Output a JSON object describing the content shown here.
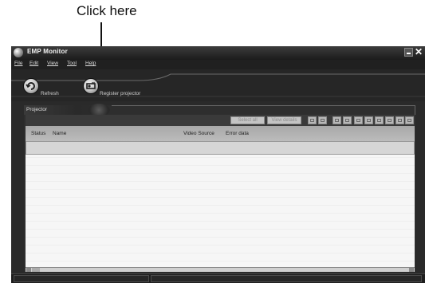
{
  "annotation": {
    "callout_text": "Click here"
  },
  "window": {
    "title": "EMP Monitor"
  },
  "menu": {
    "items": [
      "File",
      "Edit",
      "View",
      "Tool",
      "Help"
    ]
  },
  "toolbar": {
    "refresh_label": "Refresh",
    "register_label": "Register projector"
  },
  "panel": {
    "tab_label": "Projector",
    "buttons": {
      "select_all": "Select all",
      "view_details": "View details"
    },
    "columns": [
      "Status",
      "Name",
      "Video Source",
      "Error data"
    ]
  },
  "icons": {
    "refresh": "refresh-icon",
    "register": "register-projector-icon",
    "logo": "app-logo-icon",
    "minimize": "minimize-icon",
    "close": "close-icon"
  }
}
